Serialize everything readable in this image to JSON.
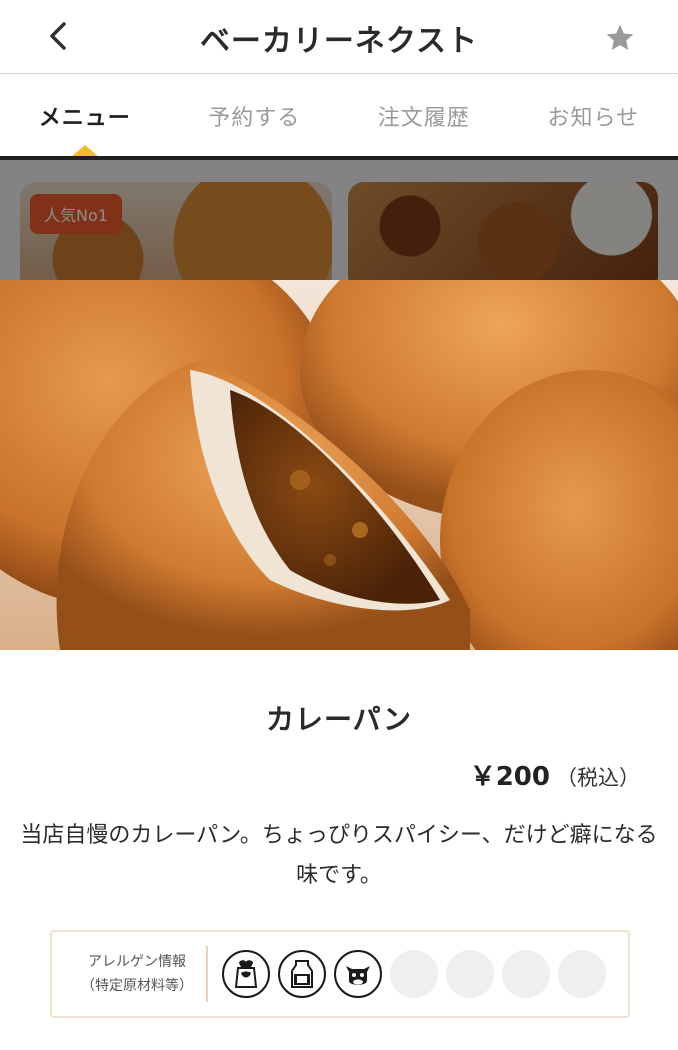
{
  "header": {
    "title": "ベーカリーネクスト",
    "back_icon": "chevron-left-icon",
    "favorite_icon": "star-icon"
  },
  "tabs": [
    {
      "label": "メニュー",
      "active": true
    },
    {
      "label": "予約する",
      "active": false
    },
    {
      "label": "注文履歴",
      "active": false
    },
    {
      "label": "お知らせ",
      "active": false
    }
  ],
  "menu_grid": {
    "badge": "人気No1"
  },
  "product": {
    "name": "カレーパン",
    "price": "￥200",
    "tax_note": "（税込）",
    "description": "当店自慢のカレーパン。ちょっぴりスパイシー、だけど癖になる味です。"
  },
  "allergen": {
    "label_line1": "アレルゲン情報",
    "label_line2": "（特定原材料等）",
    "icons": [
      {
        "name": "wheat-flour-icon",
        "active": true
      },
      {
        "name": "milk-icon",
        "active": true
      },
      {
        "name": "beef-icon",
        "active": true
      },
      {
        "name": "empty-slot",
        "active": false
      },
      {
        "name": "empty-slot",
        "active": false
      },
      {
        "name": "empty-slot",
        "active": false
      },
      {
        "name": "empty-slot",
        "active": false
      }
    ]
  },
  "colors": {
    "accent": "#f4bb2a",
    "badge": "#e9592b",
    "allergen_border": "#ece3cf"
  }
}
